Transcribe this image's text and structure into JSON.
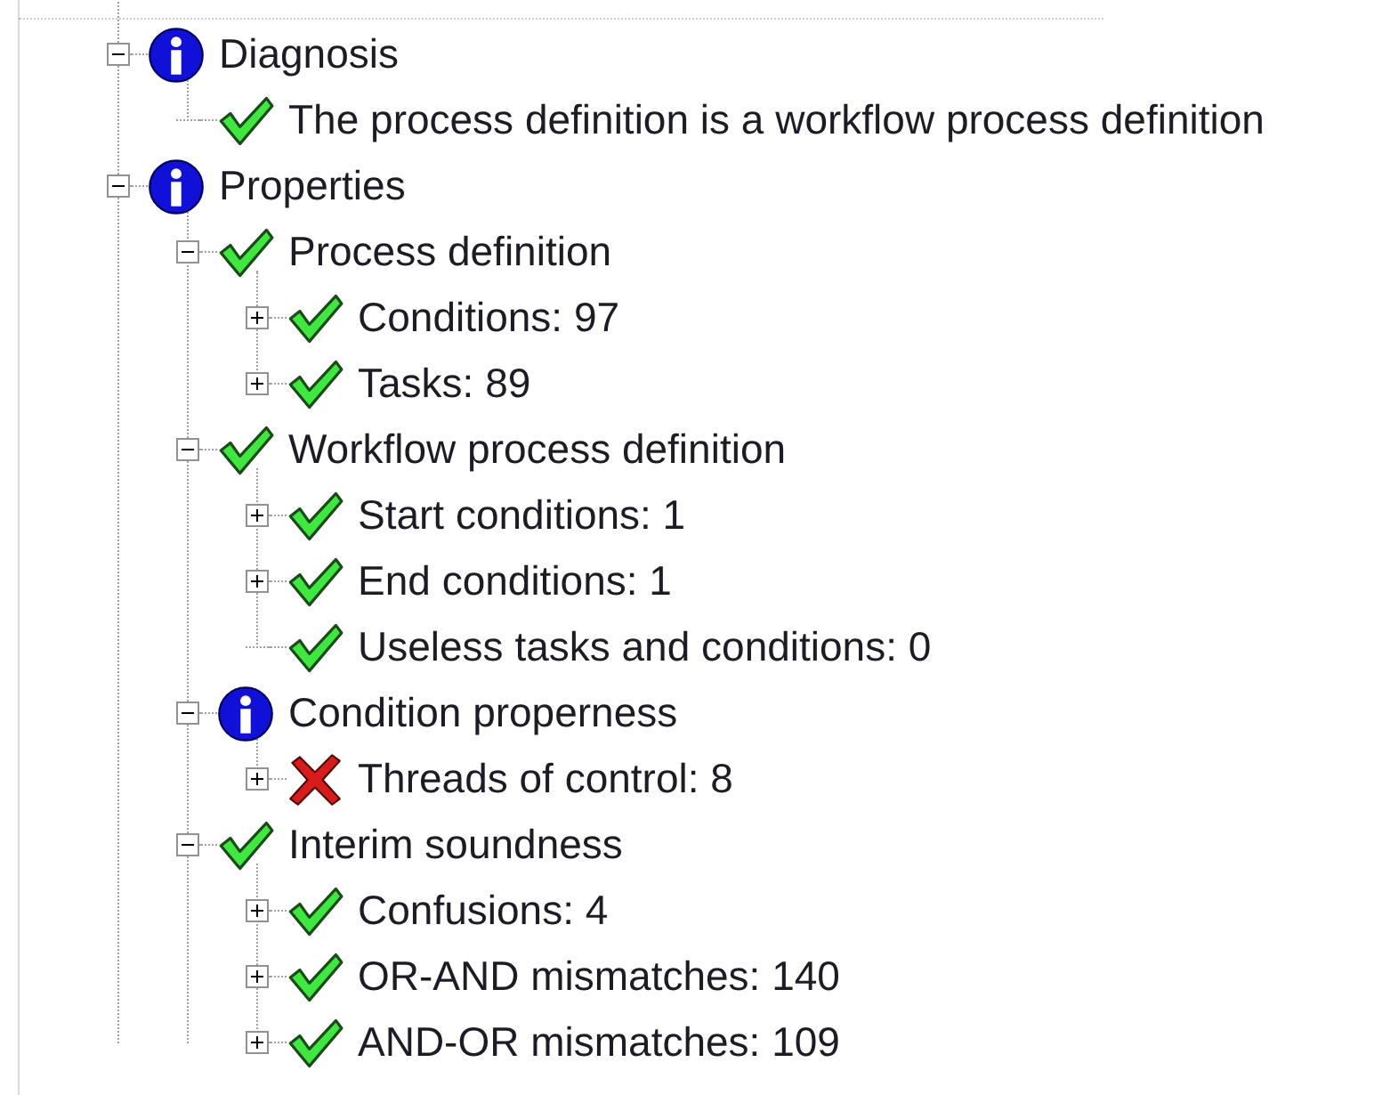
{
  "tree": [
    {
      "label": "Diagnosis",
      "kind": "info",
      "expanded": true,
      "children": [
        {
          "label": "The process definition is a workflow process definition",
          "kind": "ok"
        }
      ]
    },
    {
      "label": "Properties",
      "kind": "info",
      "expanded": true,
      "children": [
        {
          "label": "Process definition",
          "kind": "ok",
          "expanded": true,
          "children": [
            {
              "label": "Conditions: 97",
              "kind": "ok",
              "expanded": false
            },
            {
              "label": "Tasks: 89",
              "kind": "ok",
              "expanded": false
            }
          ]
        },
        {
          "label": "Workflow process definition",
          "kind": "ok",
          "expanded": true,
          "children": [
            {
              "label": "Start conditions: 1",
              "kind": "ok",
              "expanded": false
            },
            {
              "label": "End conditions: 1",
              "kind": "ok",
              "expanded": false
            },
            {
              "label": "Useless tasks and conditions: 0",
              "kind": "ok"
            }
          ]
        },
        {
          "label": "Condition properness",
          "kind": "info",
          "expanded": true,
          "children": [
            {
              "label": "Threads of control: 8",
              "kind": "error",
              "expanded": false
            }
          ]
        },
        {
          "label": "Interim soundness",
          "kind": "ok",
          "expanded": true,
          "children": [
            {
              "label": "Confusions: 4",
              "kind": "ok",
              "expanded": false
            },
            {
              "label": "OR-AND mismatches: 140",
              "kind": "ok",
              "expanded": false
            },
            {
              "label": "AND-OR mismatches: 109",
              "kind": "ok",
              "expanded": false
            }
          ]
        }
      ]
    }
  ]
}
